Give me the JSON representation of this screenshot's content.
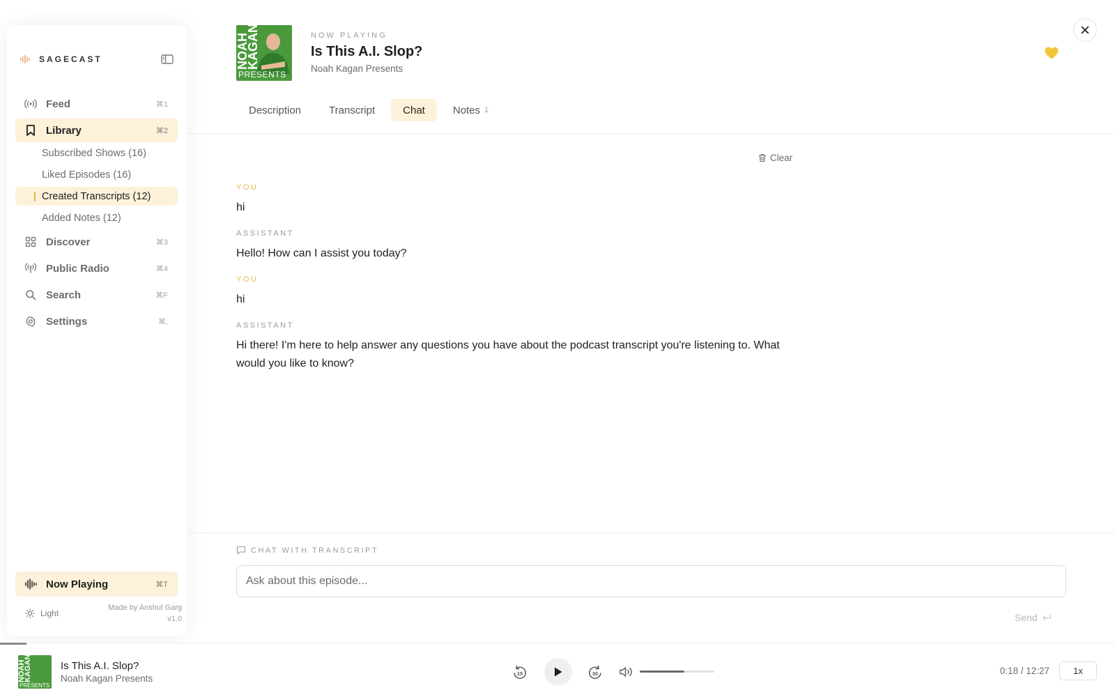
{
  "brand": {
    "name": "SAGECAST"
  },
  "sidebar": {
    "nav": [
      {
        "label": "Feed",
        "shortcut": "⌘1",
        "icon": "broadcast-icon"
      },
      {
        "label": "Library",
        "shortcut": "⌘2",
        "icon": "bookmark-icon",
        "active": true
      },
      {
        "label": "Discover",
        "shortcut": "⌘3",
        "icon": "grid-icon"
      },
      {
        "label": "Public Radio",
        "shortcut": "⌘4",
        "icon": "radio-tower-icon"
      },
      {
        "label": "Search",
        "shortcut": "⌘F",
        "icon": "search-icon"
      },
      {
        "label": "Settings",
        "shortcut": "⌘,",
        "icon": "gear-icon"
      }
    ],
    "library_sub": [
      {
        "label": "Subscribed Shows (16)"
      },
      {
        "label": "Liked Episodes (16)"
      },
      {
        "label": "Created Transcripts (12)",
        "active": true
      },
      {
        "label": "Added Notes (12)"
      }
    ],
    "now_playing": {
      "label": "Now Playing",
      "shortcut": "⌘T"
    },
    "theme": "Light",
    "made_by": "Made by Anshul Garg",
    "version": "v1.0"
  },
  "header": {
    "now_playing_label": "NOW PLAYING",
    "episode_title": "Is This A.I. Slop?",
    "show_name": "Noah Kagan Presents",
    "artwork_text": "NOAH KAGAN",
    "artwork_subtext": "PRESENTS",
    "liked": true
  },
  "tabs": [
    {
      "label": "Description"
    },
    {
      "label": "Transcript"
    },
    {
      "label": "Chat",
      "active": true
    },
    {
      "label": "Notes",
      "count": "1"
    }
  ],
  "chat": {
    "clear_label": "Clear",
    "messages": [
      {
        "role": "YOU",
        "text": "hi"
      },
      {
        "role": "ASSISTANT",
        "text": "Hello! How can I assist you today?"
      },
      {
        "role": "YOU",
        "text": "hi"
      },
      {
        "role": "ASSISTANT",
        "text": "Hi there! I'm here to help answer any questions you have about the podcast transcript you're listening to. What would you like to know?"
      }
    ],
    "input_label": "CHAT WITH TRANSCRIPT",
    "placeholder": "Ask about this episode...",
    "send_label": "Send"
  },
  "player": {
    "title": "Is This A.I. Slop?",
    "show": "Noah Kagan Presents",
    "time": "0:18 / 12:27",
    "progress_fraction": 0.024,
    "volume_fraction": 0.6,
    "speed": "1x",
    "skip_back_seconds": "15",
    "skip_forward_seconds": "30"
  },
  "colors": {
    "accent": "#fdf1d9",
    "accent_strong": "#e8b84a",
    "heart": "#f3c53b",
    "artwork": "#4a9a3c"
  }
}
